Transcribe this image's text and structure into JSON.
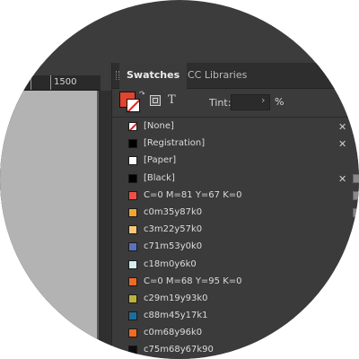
{
  "ruler": {
    "value": "1500"
  },
  "panel": {
    "tabs": [
      {
        "label": "Swatches",
        "active": true
      },
      {
        "label": "CC Libraries",
        "active": false
      }
    ],
    "tint": {
      "label": "Tint:",
      "value": "",
      "unit": "%"
    },
    "swatches": [
      {
        "name": "[None]",
        "color": "none",
        "locked": true,
        "mode": false
      },
      {
        "name": "[Registration]",
        "color": "#000000",
        "locked": true,
        "mode": false
      },
      {
        "name": "[Paper]",
        "color": "#ffffff",
        "locked": false,
        "mode": false
      },
      {
        "name": "[Black]",
        "color": "#000000",
        "locked": true,
        "mode": true
      },
      {
        "name": "C=0 M=81 Y=67 K=0",
        "color": "#f04f45",
        "locked": false,
        "mode": true
      },
      {
        "name": "c0m35y87k0",
        "color": "#f5a532",
        "locked": false,
        "mode": true
      },
      {
        "name": "c3m22y57k0",
        "color": "#f5c77a",
        "locked": false,
        "mode": false
      },
      {
        "name": "c71m53y0k0",
        "color": "#5a72bd",
        "locked": false,
        "mode": false
      },
      {
        "name": "c18m0y6k0",
        "color": "#d3ecf0",
        "locked": false,
        "mode": false
      },
      {
        "name": "C=0 M=68 Y=95 K=0",
        "color": "#f06a24",
        "locked": false,
        "mode": false
      },
      {
        "name": "c29m19y93k0",
        "color": "#bcb13a",
        "locked": false,
        "mode": false
      },
      {
        "name": "c88m45y17k1",
        "color": "#1a6f9e",
        "locked": false,
        "mode": false
      },
      {
        "name": "c0m68y96k0",
        "color": "#f26b21",
        "locked": false,
        "mode": false
      },
      {
        "name": "c75m68y67k90",
        "color": "#0d0d0d",
        "locked": false,
        "mode": false
      }
    ]
  },
  "colors": {
    "fill": "#e2442f",
    "stroke": "#ffffff"
  }
}
